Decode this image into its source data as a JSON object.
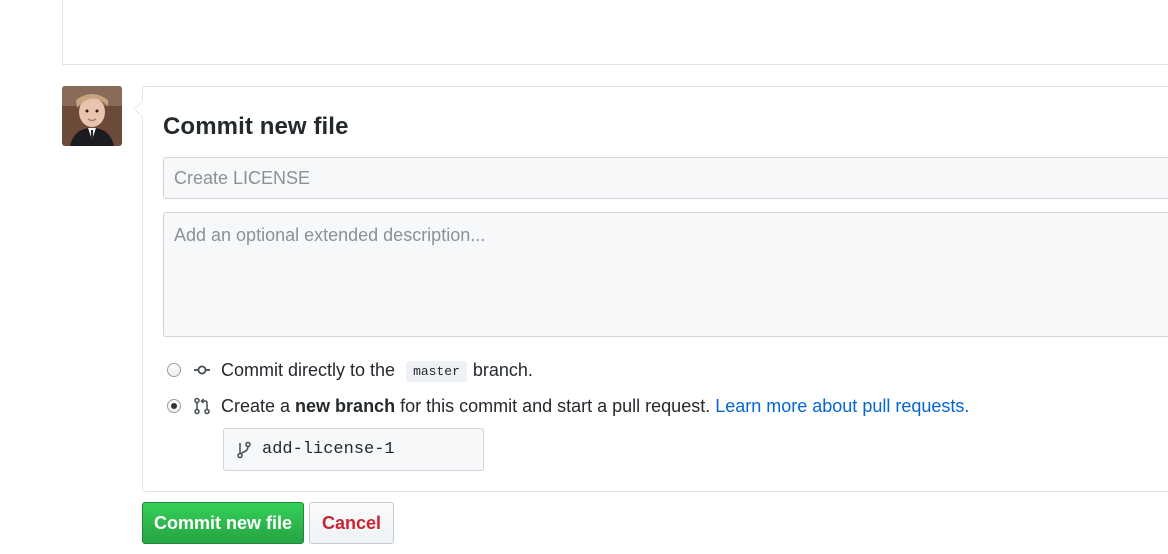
{
  "commit_form": {
    "title": "Commit new file",
    "summary_placeholder": "Create LICENSE",
    "description_placeholder": "Add an optional extended description...",
    "option_direct": {
      "text_before": "Commit directly to the",
      "branch": "master",
      "text_after": "branch.",
      "selected": false,
      "icon": "git-commit-icon"
    },
    "option_new_branch": {
      "text_before": "Create a",
      "bold": "new branch",
      "text_after": "for this commit and start a pull request.",
      "link": "Learn more about pull requests.",
      "selected": true,
      "icon": "git-pull-request-icon"
    },
    "new_branch_name": "add-license-1",
    "branch_icon": "git-branch-icon"
  },
  "buttons": {
    "commit": "Commit new file",
    "cancel": "Cancel"
  },
  "colors": {
    "primary_green": "#28a745",
    "link_blue": "#0366d6",
    "cancel_red": "#cb2431"
  }
}
